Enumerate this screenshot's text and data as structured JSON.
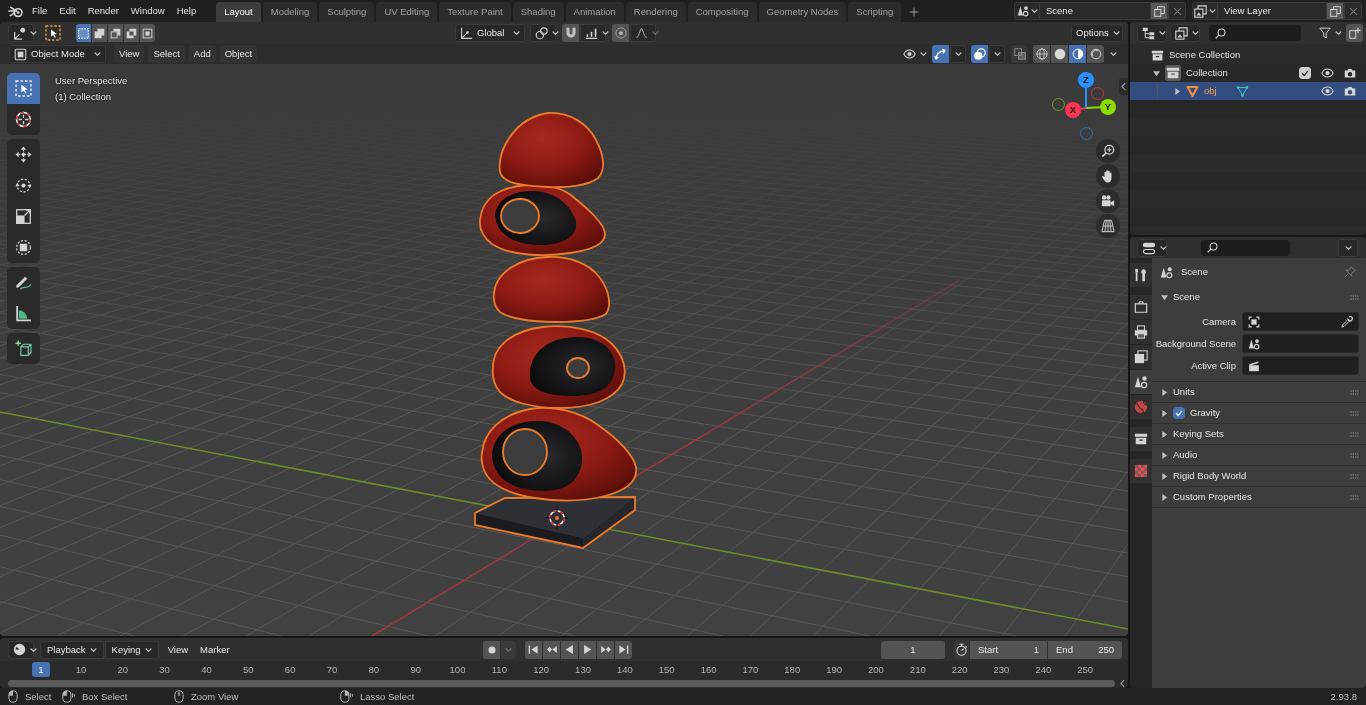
{
  "topbar": {
    "menus": [
      "File",
      "Edit",
      "Render",
      "Window",
      "Help"
    ],
    "workspace_tabs": [
      {
        "label": "Layout",
        "selected": true
      },
      {
        "label": "Modeling",
        "selected": false
      },
      {
        "label": "Sculpting",
        "selected": false
      },
      {
        "label": "UV Editing",
        "selected": false
      },
      {
        "label": "Texture Paint",
        "selected": false
      },
      {
        "label": "Shading",
        "selected": false
      },
      {
        "label": "Animation",
        "selected": false
      },
      {
        "label": "Rendering",
        "selected": false
      },
      {
        "label": "Compositing",
        "selected": false
      },
      {
        "label": "Geometry Nodes",
        "selected": false
      },
      {
        "label": "Scripting",
        "selected": false
      }
    ],
    "scene": "Scene",
    "view_layer": "View Layer"
  },
  "viewport": {
    "tool_header": {
      "select_modes": [
        {
          "kind": "set",
          "selected": true
        },
        {
          "kind": "extend",
          "selected": false
        },
        {
          "kind": "subtract",
          "selected": false
        },
        {
          "kind": "invert",
          "selected": false
        },
        {
          "kind": "intersect",
          "selected": false
        }
      ],
      "transform_orientation": "Global",
      "options": "Options"
    },
    "header": {
      "mode": "Object Mode",
      "menus": [
        "View",
        "Select",
        "Add",
        "Object"
      ],
      "gizmos_on": true,
      "overlays_on": true,
      "xray_on": false,
      "shading": [
        {
          "kind": "wireframe",
          "selected": false
        },
        {
          "kind": "solid",
          "selected": false
        },
        {
          "kind": "material",
          "selected": true
        },
        {
          "kind": "rendered",
          "selected": false
        }
      ]
    },
    "info": [
      "User Perspective",
      "(1) Collection"
    ],
    "tools": [
      [
        {
          "kind": "select_box",
          "selected": true
        },
        {
          "kind": "cursor",
          "selected": false
        }
      ],
      [
        {
          "kind": "move",
          "selected": false
        },
        {
          "kind": "rotate",
          "selected": false
        },
        {
          "kind": "scale",
          "selected": false
        },
        {
          "kind": "transform",
          "selected": false
        }
      ],
      [
        {
          "kind": "annotate",
          "selected": false
        },
        {
          "kind": "measure",
          "selected": false
        }
      ],
      [
        {
          "kind": "add_cube",
          "selected": false
        }
      ]
    ],
    "gizmo": {
      "axes": [
        {
          "label": "X",
          "color": "#ff3352"
        },
        {
          "label": "Y",
          "color": "#8bdc00"
        },
        {
          "label": "Z",
          "color": "#2890ff"
        }
      ]
    }
  },
  "outliner": {
    "items": [
      {
        "kind": "scene_collection",
        "label": "Scene Collection",
        "selected": false,
        "children": [
          {
            "kind": "collection",
            "label": "Collection",
            "expanded": true,
            "checked": true,
            "selected": false,
            "children": [
              {
                "kind": "mesh_object",
                "label": "obj",
                "expanded": false,
                "selected": true
              }
            ]
          }
        ]
      }
    ]
  },
  "properties": {
    "tabs": [
      [
        {
          "kind": "tool",
          "selected": false
        }
      ],
      [
        {
          "kind": "render",
          "selected": false
        },
        {
          "kind": "output",
          "selected": false
        },
        {
          "kind": "view_layer",
          "selected": false
        },
        {
          "kind": "scene",
          "selected": true
        },
        {
          "kind": "world",
          "selected": false
        }
      ],
      [
        {
          "kind": "collection",
          "selected": false
        }
      ],
      [
        {
          "kind": "texture",
          "selected": false
        }
      ]
    ],
    "breadcrumb": "Scene",
    "panels": [
      {
        "title": "Scene",
        "expanded": true,
        "fields": [
          {
            "kind": "camera",
            "label": "Camera"
          },
          {
            "kind": "scene",
            "label": "Background Scene"
          },
          {
            "kind": "clip",
            "label": "Active Clip"
          }
        ]
      },
      {
        "title": "Units",
        "expanded": false
      },
      {
        "title": "Gravity",
        "expanded": false,
        "checked": true
      },
      {
        "title": "Keying Sets",
        "expanded": false
      },
      {
        "title": "Audio",
        "expanded": false
      },
      {
        "title": "Rigid Body World",
        "expanded": false
      },
      {
        "title": "Custom Properties",
        "expanded": false
      }
    ]
  },
  "timeline": {
    "menus": [
      {
        "kind": "dropdown",
        "label": "Playback"
      },
      {
        "kind": "dropdown",
        "label": "Keying"
      },
      {
        "kind": "plain",
        "label": "View"
      },
      {
        "kind": "plain",
        "label": "Marker"
      }
    ],
    "current_frame": "1",
    "start": {
      "label": "Start",
      "value": "1"
    },
    "end": {
      "label": "End",
      "value": "250"
    },
    "ruler": [
      {
        "label": "1",
        "selected": true
      },
      {
        "label": "10",
        "selected": false
      },
      {
        "label": "20",
        "selected": false
      },
      {
        "label": "30",
        "selected": false
      },
      {
        "label": "40",
        "selected": false
      },
      {
        "label": "50",
        "selected": false
      },
      {
        "label": "60",
        "selected": false
      },
      {
        "label": "70",
        "selected": false
      },
      {
        "label": "80",
        "selected": false
      },
      {
        "label": "90",
        "selected": false
      },
      {
        "label": "100",
        "selected": false
      },
      {
        "label": "110",
        "selected": false
      },
      {
        "label": "120",
        "selected": false
      },
      {
        "label": "130",
        "selected": false
      },
      {
        "label": "140",
        "selected": false
      },
      {
        "label": "150",
        "selected": false
      },
      {
        "label": "160",
        "selected": false
      },
      {
        "label": "170",
        "selected": false
      },
      {
        "label": "180",
        "selected": false
      },
      {
        "label": "190",
        "selected": false
      },
      {
        "label": "200",
        "selected": false
      },
      {
        "label": "210",
        "selected": false
      },
      {
        "label": "220",
        "selected": false
      },
      {
        "label": "230",
        "selected": false
      },
      {
        "label": "240",
        "selected": false
      },
      {
        "label": "250",
        "selected": false
      }
    ]
  },
  "status_bar": {
    "hints": [
      {
        "kind": "click",
        "label": "Select"
      },
      {
        "kind": "drag",
        "label": "Box Select"
      },
      {
        "kind": "middle",
        "label": "Zoom View"
      },
      {
        "kind": "right_drag",
        "label": "Lasso Select"
      }
    ],
    "version": "2.93.8"
  }
}
